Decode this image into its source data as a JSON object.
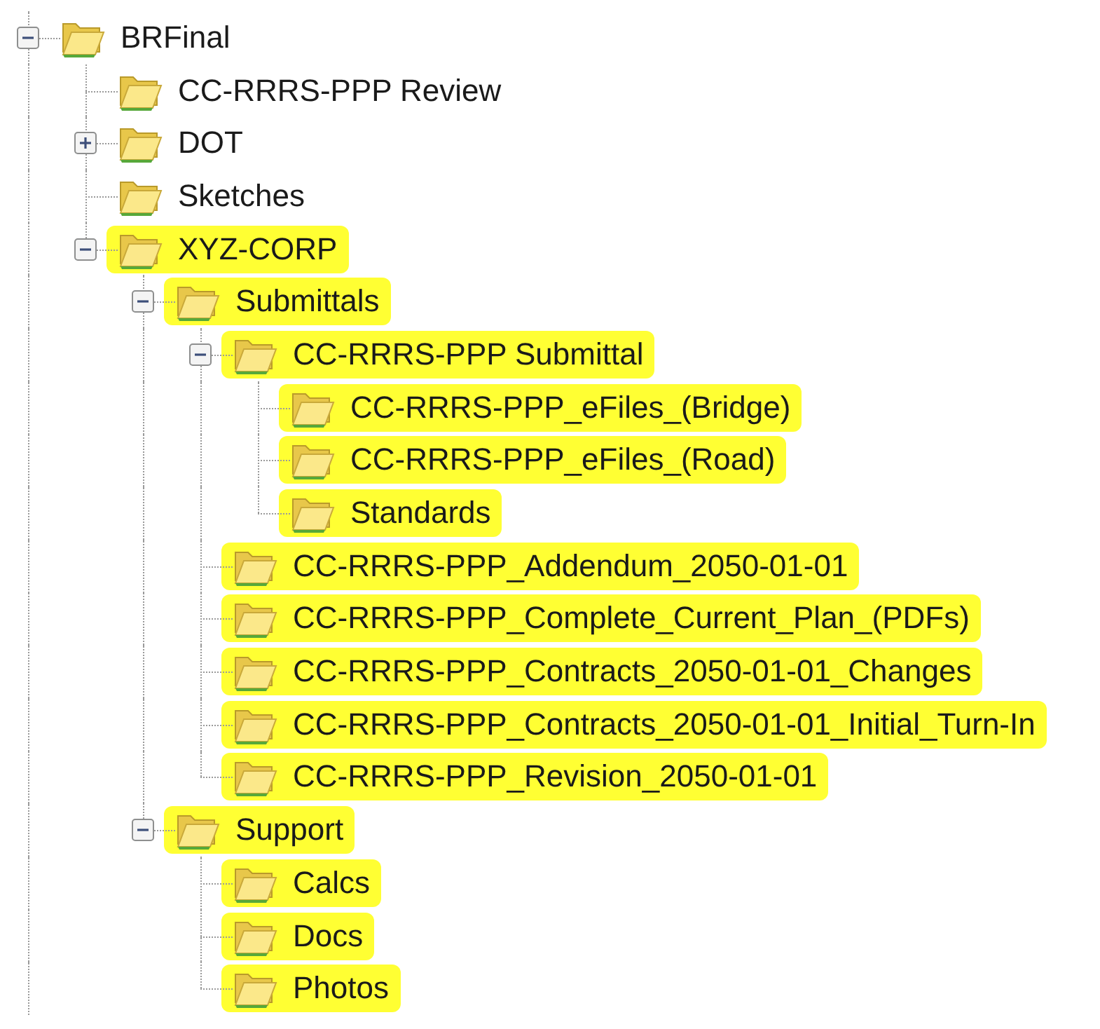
{
  "tree": {
    "continues_below": true,
    "items": [
      {
        "name": "BRFinal",
        "expanded": true,
        "highlighted": false,
        "children": [
          {
            "name": "CC-RRRS-PPP Review",
            "highlighted": false
          },
          {
            "name": "DOT",
            "expanded": false,
            "highlighted": false
          },
          {
            "name": "Sketches",
            "highlighted": false
          },
          {
            "name": "XYZ-CORP",
            "expanded": true,
            "highlighted": true,
            "children": [
              {
                "name": "Submittals",
                "expanded": true,
                "highlighted": true,
                "children": [
                  {
                    "name": "CC-RRRS-PPP Submittal",
                    "expanded": true,
                    "highlighted": true,
                    "children": [
                      {
                        "name": "CC-RRRS-PPP_eFiles_(Bridge)",
                        "highlighted": true
                      },
                      {
                        "name": "CC-RRRS-PPP_eFiles_(Road)",
                        "highlighted": true
                      },
                      {
                        "name": "Standards",
                        "highlighted": true
                      }
                    ]
                  },
                  {
                    "name": "CC-RRRS-PPP_Addendum_2050-01-01",
                    "highlighted": true
                  },
                  {
                    "name": "CC-RRRS-PPP_Complete_Current_Plan_(PDFs)",
                    "highlighted": true
                  },
                  {
                    "name": "CC-RRRS-PPP_Contracts_2050-01-01_Changes",
                    "highlighted": true
                  },
                  {
                    "name": "CC-RRRS-PPP_Contracts_2050-01-01_Initial_Turn-In",
                    "highlighted": true
                  },
                  {
                    "name": "CC-RRRS-PPP_Revision_2050-01-01",
                    "highlighted": true
                  }
                ]
              },
              {
                "name": "Support",
                "expanded": true,
                "highlighted": true,
                "children": [
                  {
                    "name": "Calcs",
                    "highlighted": true
                  },
                  {
                    "name": "Docs",
                    "highlighted": true
                  },
                  {
                    "name": "Photos",
                    "highlighted": true
                  }
                ]
              }
            ]
          }
        ]
      }
    ]
  }
}
